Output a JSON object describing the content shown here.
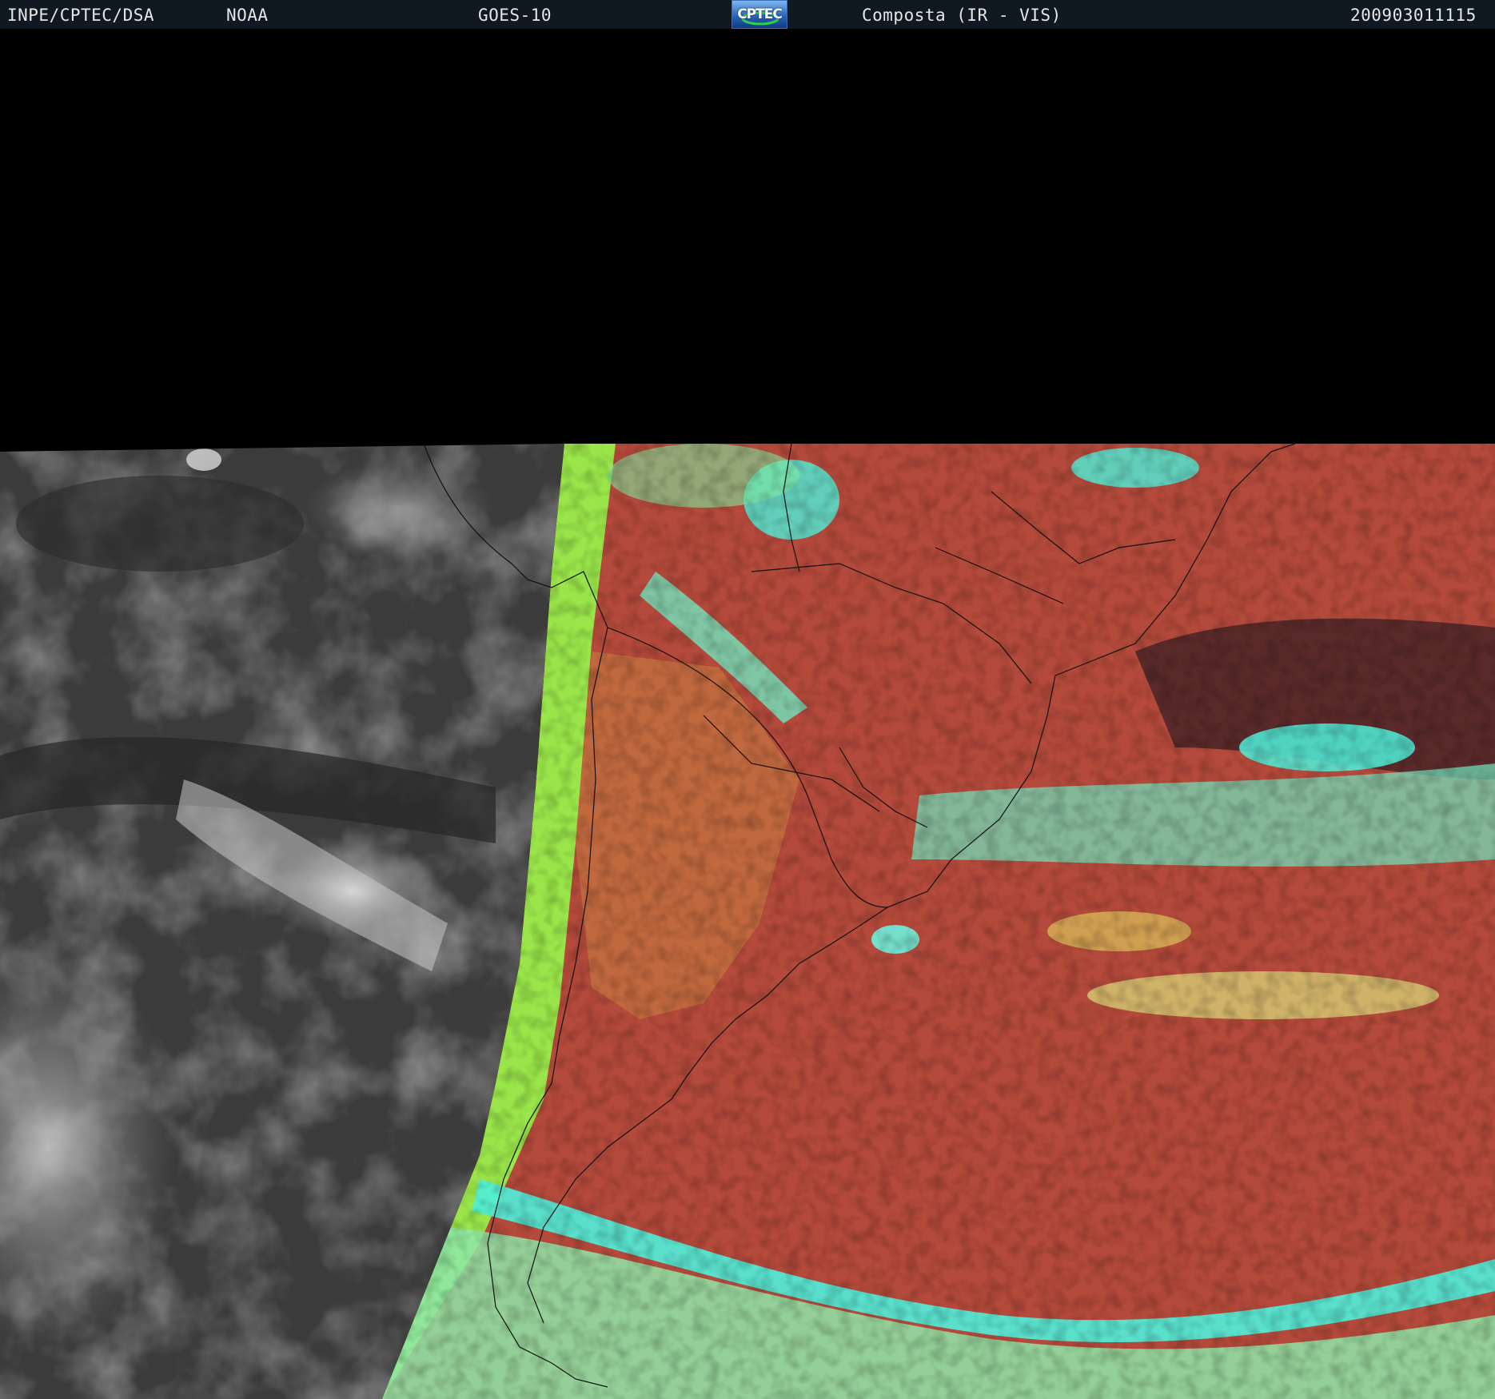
{
  "header": {
    "institution": "INPE/CPTEC/DSA",
    "agency": "NOAA",
    "satellite": "GOES-10",
    "logo_text": "CPTEC",
    "product": "Composta (IR - VIS)",
    "timestamp": "200903011115"
  },
  "colors": {
    "header_bg": "#101822",
    "ocean_gray": "#3a3a3a",
    "land_red": "#b24a3a",
    "cloud_cyan": "#4ef0d8",
    "cloud_lime": "#9aea4a"
  }
}
